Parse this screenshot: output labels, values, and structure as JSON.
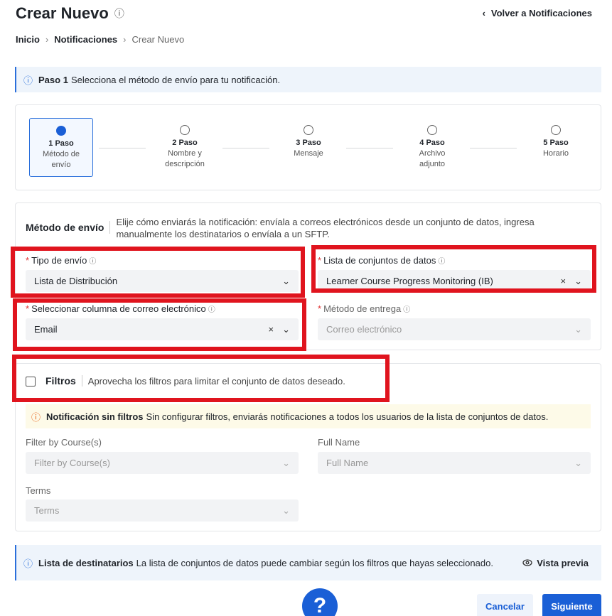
{
  "header": {
    "title": "Crear Nuevo",
    "back_label": "Volver a Notificaciones"
  },
  "breadcrumb": [
    "Inicio",
    "Notificaciones",
    "Crear Nuevo"
  ],
  "step_banner": {
    "strong": "Paso 1",
    "text": "Selecciona el método de envío para tu notificación."
  },
  "steps": [
    {
      "label": "1 Paso",
      "sub1": "Método de",
      "sub2": "envío",
      "active": true
    },
    {
      "label": "2 Paso",
      "sub1": "Nombre y",
      "sub2": "descripción",
      "active": false
    },
    {
      "label": "3 Paso",
      "sub1": "Mensaje",
      "sub2": "",
      "active": false
    },
    {
      "label": "4 Paso",
      "sub1": "Archivo",
      "sub2": "adjunto",
      "active": false
    },
    {
      "label": "5 Paso",
      "sub1": "Horario",
      "sub2": "",
      "active": false
    }
  ],
  "method": {
    "title": "Método de envío",
    "description": "Elije cómo enviarás la notificación: envíala a correos electrónicos desde un conjunto de datos, ingresa manualmente los destinatarios o envíala a un SFTP.",
    "fields": {
      "tipo_label": "Tipo de envío",
      "tipo_value": "Lista de Distribución",
      "lista_label": "Lista de conjuntos de datos",
      "lista_value": "Learner Course Progress Monitoring (IB)",
      "columna_label": "Seleccionar columna de correo electrónico",
      "columna_value": "Email",
      "entrega_label": "Método de entrega",
      "entrega_value": "Correo electrónico"
    }
  },
  "filters": {
    "title": "Filtros",
    "description": "Aprovecha los filtros para limitar el conjunto de datos deseado.",
    "warning_strong": "Notificación sin filtros",
    "warning_text": "Sin configurar filtros, enviarás notificaciones a todos los usuarios de la lista de conjuntos de datos.",
    "course_label": "Filter by Course(s)",
    "course_placeholder": "Filter by Course(s)",
    "fullname_label": "Full Name",
    "fullname_placeholder": "Full Name",
    "terms_label": "Terms",
    "terms_placeholder": "Terms"
  },
  "recipients_banner": {
    "strong": "Lista de destinatarios",
    "text": "La lista de conjuntos de datos puede cambiar según los filtros que hayas seleccionado.",
    "preview_label": "Vista previa"
  },
  "footer": {
    "help_label": "?",
    "cancel_label": "Cancelar",
    "next_label": "Siguiente"
  },
  "colors": {
    "primary": "#1a5fd6",
    "highlight_red": "#e0141e",
    "required": "#e03131"
  }
}
